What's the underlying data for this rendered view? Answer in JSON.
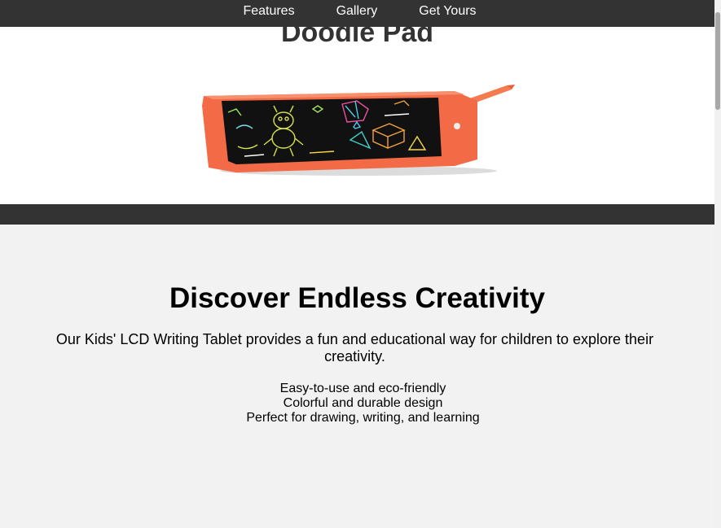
{
  "nav": {
    "items": [
      {
        "label": "Features"
      },
      {
        "label": "Gallery"
      },
      {
        "label": "Get Yours"
      }
    ]
  },
  "header": {
    "title": "Doodle Pad"
  },
  "product": {
    "body_color": "#f26b46",
    "screen_color": "#111111"
  },
  "main": {
    "heading": "Discover Endless Creativity",
    "lead": "Our Kids' LCD Writing Tablet provides a fun and educational way for children to explore their creativity.",
    "features": [
      "Easy-to-use and eco-friendly",
      "Colorful and durable design",
      "Perfect for drawing, writing, and learning"
    ]
  },
  "colors": {
    "nav_bg": "#333333",
    "page_bg": "#f2f2f2",
    "header_bg": "#ffffff"
  }
}
